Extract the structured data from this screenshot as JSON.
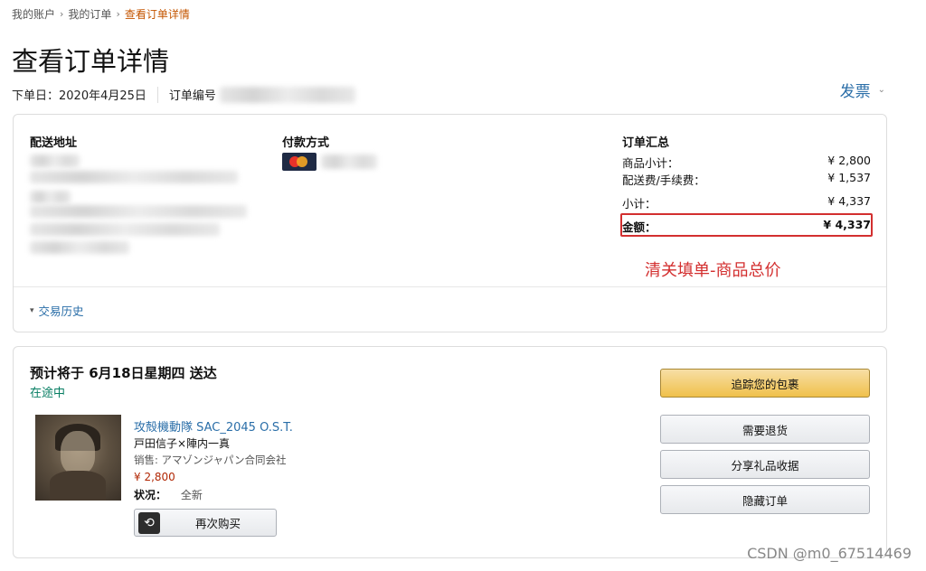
{
  "breadcrumb": {
    "items": [
      "我的账户",
      "我的订单",
      "查看订单详情"
    ],
    "separator": "›"
  },
  "page": {
    "title": "查看订单详情",
    "order_date": "下单日：2020年4月25日",
    "order_number_label": "订单编号",
    "invoice_label": "发票"
  },
  "shipping": {
    "title": "配送地址"
  },
  "payment": {
    "title": "付款方式"
  },
  "summary": {
    "title": "订单汇总",
    "rows": [
      {
        "label": "商品小计：",
        "value": "¥ 2,800"
      },
      {
        "label": "配送费/手续费：",
        "value": "¥ 1,537"
      },
      {
        "label": "小计：",
        "value": "¥ 4,337"
      }
    ],
    "total": {
      "label": "金额：",
      "value": "¥ 4,337"
    },
    "annotation": "清关填单-商品总价"
  },
  "history": {
    "label": "交易历史"
  },
  "shipment": {
    "heading": "预计将于 6月18日星期四 送达",
    "status": "在途中",
    "item": {
      "title": "攻殻機動隊 SAC_2045 O.S.T.",
      "artist": "戸田信子×陣内一真",
      "seller": "销售: アマゾンジャパン合同会社",
      "price": "¥ 2,800",
      "condition_label": "状况：",
      "condition_value": "全新"
    },
    "rebuy_label": "再次购买",
    "actions": {
      "track": "追踪您的包裹",
      "return": "需要退货",
      "gift_receipt": "分享礼品收据",
      "hide": "隐藏订单"
    }
  },
  "watermark": "CSDN @m0_67514469",
  "colors": {
    "link": "#2a6ea8",
    "breadcrumb_current": "#c45500",
    "status_green": "#067d62",
    "price_red": "#b12704",
    "highlight_red": "#d32f2f",
    "primary_button": "#f0c14b"
  },
  "icons": [
    "mastercard-logo",
    "rebuy-icon",
    "chevron-down-icon"
  ]
}
